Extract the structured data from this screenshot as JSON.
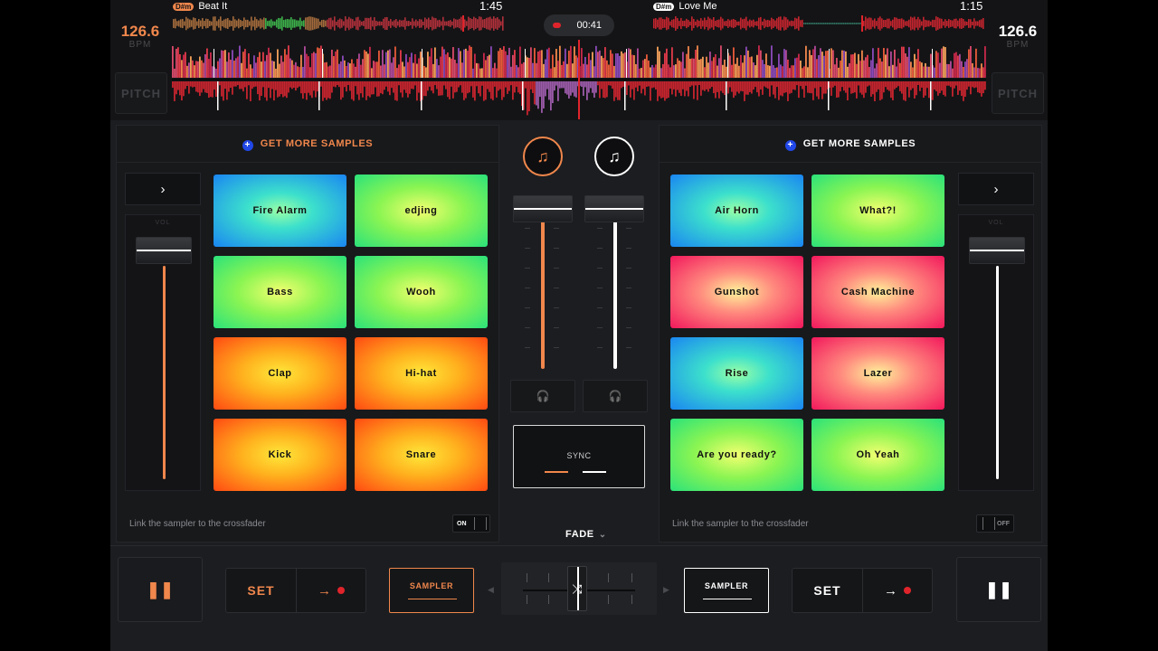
{
  "colors": {
    "accent_left": "#f0874c",
    "accent_right": "#ffffff",
    "rec": "#e0242b",
    "plus_blue": "#2148e8"
  },
  "deck_left": {
    "bpm": "126.6",
    "bpm_unit": "BPM",
    "pitch_label": "PITCH",
    "key": "D#m",
    "title": "Beat It",
    "time": "1:45"
  },
  "deck_right": {
    "bpm": "126.6",
    "bpm_unit": "BPM",
    "pitch_label": "PITCH",
    "key": "D#m",
    "title": "Love Me",
    "time": "1:15"
  },
  "recording": {
    "time": "00:41"
  },
  "sampler_left": {
    "get_more": "GET MORE SAMPLES",
    "arrow": "›",
    "vol_label": "VOL",
    "pads": [
      {
        "label": "Fire Alarm",
        "color": "blue"
      },
      {
        "label": "edjing",
        "color": "green"
      },
      {
        "label": "Bass",
        "color": "green"
      },
      {
        "label": "Wooh",
        "color": "green"
      },
      {
        "label": "Clap",
        "color": "orange"
      },
      {
        "label": "Hi-hat",
        "color": "orange"
      },
      {
        "label": "Kick",
        "color": "orange"
      },
      {
        "label": "Snare",
        "color": "orange"
      }
    ],
    "link_text": "Link the sampler to the crossfader",
    "toggle": "ON"
  },
  "sampler_right": {
    "get_more": "GET MORE SAMPLES",
    "arrow": "›",
    "vol_label": "VOL",
    "pads": [
      {
        "label": "Air Horn",
        "color": "blue"
      },
      {
        "label": "What?!",
        "color": "green"
      },
      {
        "label": "Gunshot",
        "color": "pink"
      },
      {
        "label": "Cash Machine",
        "color": "pink"
      },
      {
        "label": "Rise",
        "color": "blue"
      },
      {
        "label": "Lazer",
        "color": "pink"
      },
      {
        "label": "Are you ready?",
        "color": "green"
      },
      {
        "label": "Oh Yeah",
        "color": "green"
      }
    ],
    "link_text": "Link the sampler to the crossfader",
    "toggle": "OFF"
  },
  "mixer": {
    "sync_label": "SYNC",
    "fade_label": "FADE",
    "fade_chevron": "⌄",
    "headphone_icon": "🎧"
  },
  "transport": {
    "pause_glyph": "❚❚",
    "set_label": "SET",
    "arrow_glyph": "→",
    "sampler_label": "SAMPLER",
    "xf_left": "◀",
    "xf_right": "▶",
    "xf_glyph": "⤨"
  },
  "icons": {
    "music_note": "♫",
    "plus": "+"
  }
}
